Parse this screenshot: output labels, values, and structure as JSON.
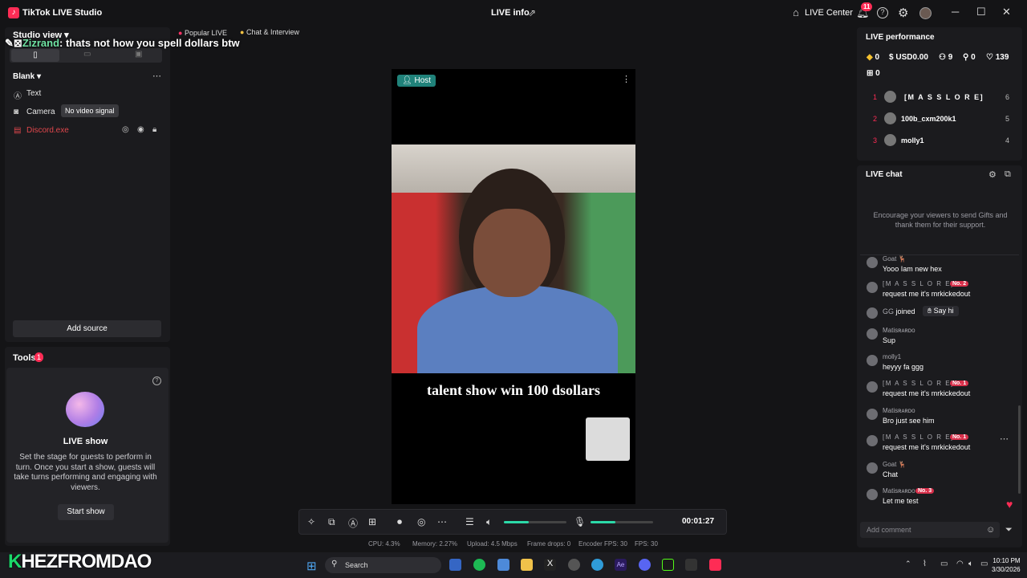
{
  "app": {
    "title": "TikTok LIVE Studio",
    "logo_glyph": "♪",
    "center_title": "LIVE info",
    "live_center_label": "LIVE Center",
    "notif_count": "11"
  },
  "left": {
    "studio_view": "Studio view",
    "overlay_user": "Zizrand",
    "overlay_msg": ": thats not how you spell dollars btw",
    "scene": "Blank",
    "sources": [
      {
        "icon": "text-icon",
        "label": "Text"
      },
      {
        "icon": "camera-icon",
        "label": "Camera"
      },
      {
        "icon": "window-capture-icon",
        "label": "Discord.exe"
      }
    ],
    "tooltip": "No video signal",
    "add_source": "Add source",
    "tools_label": "Tools",
    "tools_badge": "1",
    "live_show_title": "LIVE show",
    "live_show_desc": "Set the stage for guests to perform in turn. Once you start a show, guests will take turns performing and engaging with viewers.",
    "start_show": "Start show"
  },
  "top_pills": {
    "popular": "Popular LIVE",
    "chat_interview": "Chat & Interview"
  },
  "stage": {
    "host_badge": "Host",
    "caption": "talent show win 100 dsollars"
  },
  "controls": {
    "timer": "00:01:27",
    "volume_level": 0.4,
    "mic_level": 0.4
  },
  "stats": {
    "cpu": "CPU: 4.3%",
    "memory": "Memory: 2.27%",
    "upload": "Upload: 4.5 Mbps",
    "frame_drops": "Frame drops: 0",
    "encoder_fps": "Encoder FPS: 30",
    "fps": "FPS: 30"
  },
  "performance": {
    "title": "LIVE performance",
    "diamonds": "0",
    "usd": "USD0.00",
    "viewers": "9",
    "new_followers": "0",
    "likes": "139",
    "gifts": "0",
    "ranking": [
      {
        "rank": "1",
        "name": "[M A S S L O R E]",
        "score": "6"
      },
      {
        "rank": "2",
        "name": "100b_cxm200k1",
        "score": "5"
      },
      {
        "rank": "3",
        "name": "molly1",
        "score": "4"
      }
    ]
  },
  "chat": {
    "title": "LIVE chat",
    "encourage": "Encourage your viewers to send Gifts and thank them for their support.",
    "messages": [
      {
        "name": "Goat 🦌",
        "badge": "",
        "msg": "Yooo Iam new hex"
      },
      {
        "name": "[M A S S L O R E]",
        "badge": "No. 2",
        "msg": "request me it's mrkickedout"
      },
      {
        "name": "GG",
        "badge": "",
        "msg": "joined"
      },
      {
        "name": "Matisʀᴀʀᴅᴏ",
        "badge": "",
        "msg": "Sup"
      },
      {
        "name": "molly1",
        "badge": "",
        "msg": "heyyy fa ggg"
      },
      {
        "name": "[M A S S L O R E]",
        "badge": "No. 1",
        "msg": "request me it's mrkickedout"
      },
      {
        "name": "Matisʀᴀʀᴅᴏ",
        "badge": "",
        "msg": "Bro just see him"
      },
      {
        "name": "[M A S S L O R E]",
        "badge": "No. 1",
        "msg": "request me it's mrkickedout"
      },
      {
        "name": "Goat 🦌",
        "badge": "",
        "msg": "Chat"
      },
      {
        "name": "Matisʀᴀʀᴅᴏ",
        "badge": "No. 3",
        "msg": "Let me test"
      }
    ],
    "say_hi": "Say hi",
    "comment_placeholder": "Add comment"
  },
  "taskbar": {
    "watermark_k": "K",
    "watermark_rest": "HEZFROMDAO",
    "search": "Search",
    "time": "10:10 PM",
    "date": "3/30/2026"
  },
  "colors": {
    "accent": "#fe2c55",
    "teal": "#2bd9a8",
    "host": "#20827a"
  }
}
